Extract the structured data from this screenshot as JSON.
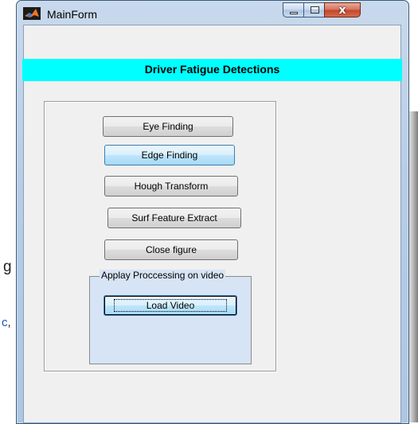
{
  "window": {
    "title": "MainForm",
    "controls": {
      "minimize": "minimize",
      "maximize": "maximize",
      "close": "x"
    }
  },
  "banner": {
    "text": "Driver Fatigue Detections",
    "color": "#00ffff"
  },
  "buttons": {
    "eye_finding": "Eye Finding",
    "edge_finding": "Edge Finding",
    "hough_transform": "Hough Transform",
    "surf_feature_extract": "Surf Feature Extract",
    "close_figure": "Close figure"
  },
  "video_group": {
    "label": "Applay Proccessing on video",
    "load_video": "Load Video",
    "background": "#d7e4f5"
  },
  "background_fragments": {
    "left_text": "g",
    "left_link": "c",
    "left_punct": ","
  }
}
